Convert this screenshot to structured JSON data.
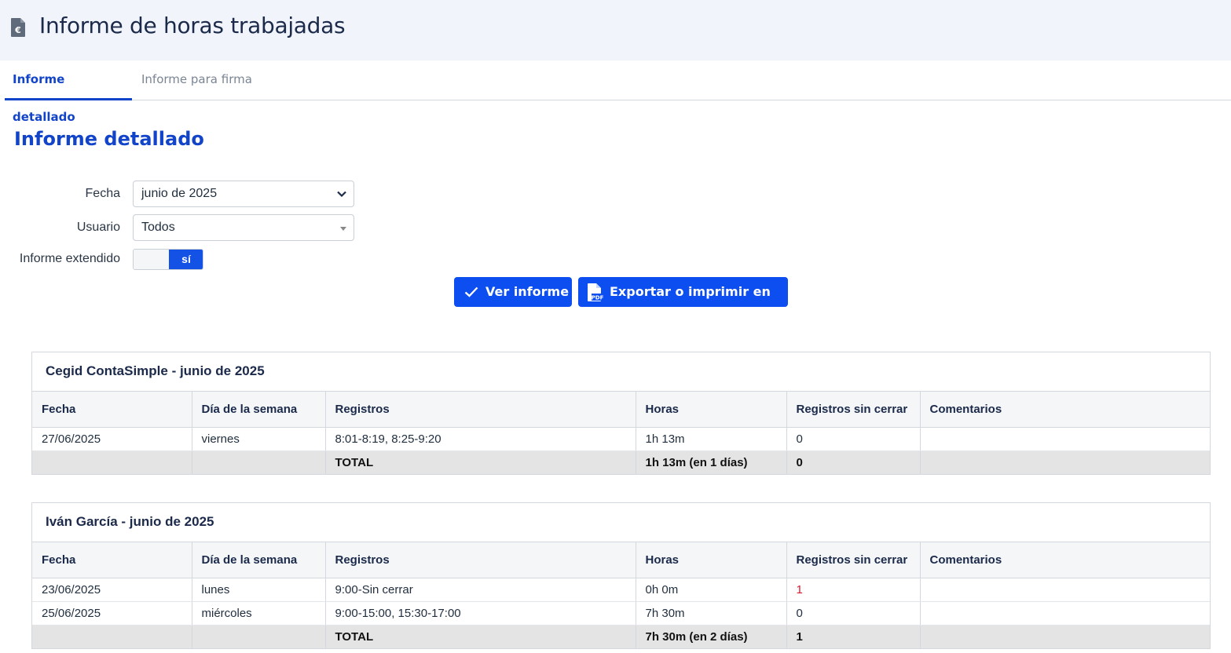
{
  "header": {
    "title": "Informe de horas trabajadas",
    "icon": "invoice-euro-icon"
  },
  "tabs": [
    {
      "label": "Informe detallado",
      "active": true
    },
    {
      "label": "Informe para firma",
      "active": false
    }
  ],
  "section_title": "Informe detallado",
  "form": {
    "fecha_label": "Fecha",
    "fecha_value": "junio de 2025",
    "usuario_label": "Usuario",
    "usuario_value": "Todos",
    "extendido_label": "Informe extendido",
    "extendido_value": "sí"
  },
  "buttons": {
    "view_label": "Ver informe",
    "pdf_label": "Exportar o imprimir en PDF"
  },
  "columns": [
    "Fecha",
    "Día de la semana",
    "Registros",
    "Horas",
    "Registros sin cerrar",
    "Comentarios"
  ],
  "reports": [
    {
      "title": "Cegid ContaSimple - junio de 2025",
      "rows": [
        {
          "fecha": "27/06/2025",
          "dia": "viernes",
          "registros": "8:01-8:19, 8:25-9:20",
          "horas": "1h 13m",
          "sin_cerrar": "0",
          "comentarios": ""
        }
      ],
      "total": {
        "label": "TOTAL",
        "horas": "1h 13m (en 1 días)",
        "sin_cerrar": "0"
      }
    },
    {
      "title": "Iván García - junio de 2025",
      "rows": [
        {
          "fecha": "23/06/2025",
          "dia": "lunes",
          "registros": "9:00-Sin cerrar",
          "horas": "0h 0m",
          "sin_cerrar": "1",
          "comentarios": ""
        },
        {
          "fecha": "25/06/2025",
          "dia": "miércoles",
          "registros": "9:00-15:00, 15:30-17:00",
          "horas": "7h 30m",
          "sin_cerrar": "0",
          "comentarios": ""
        }
      ],
      "total": {
        "label": "TOTAL",
        "horas": "7h 30m (en 2 días)",
        "sin_cerrar": "1"
      }
    }
  ],
  "colors": {
    "accent": "#1244c9",
    "button": "#0d4ef0",
    "warning": "#e0182e",
    "header_bg": "#f1f5fb"
  }
}
